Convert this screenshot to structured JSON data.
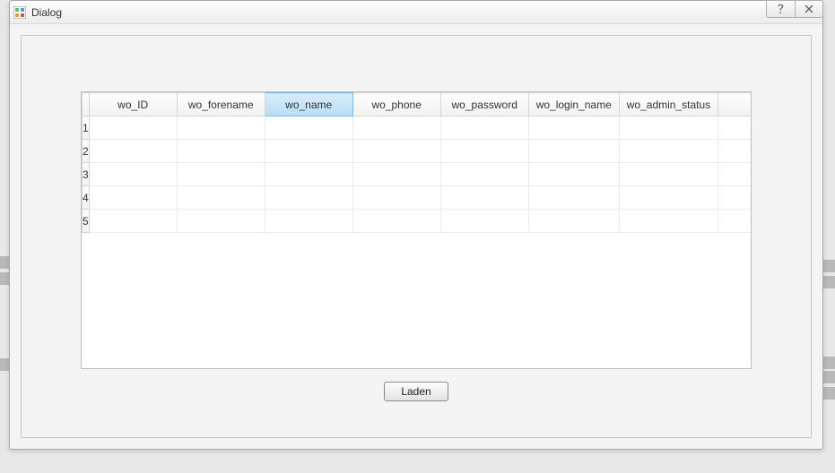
{
  "dialog": {
    "title": "Dialog",
    "help_tooltip": "?",
    "close_tooltip": "✕"
  },
  "table": {
    "columns": [
      "wo_ID",
      "wo_forename",
      "wo_name",
      "wo_phone",
      "wo_password",
      "wo_login_name",
      "wo_admin_status"
    ],
    "selected_column_index": 2,
    "rows": [
      "1",
      "2",
      "3",
      "4",
      "5"
    ]
  },
  "buttons": {
    "load": "Laden"
  }
}
